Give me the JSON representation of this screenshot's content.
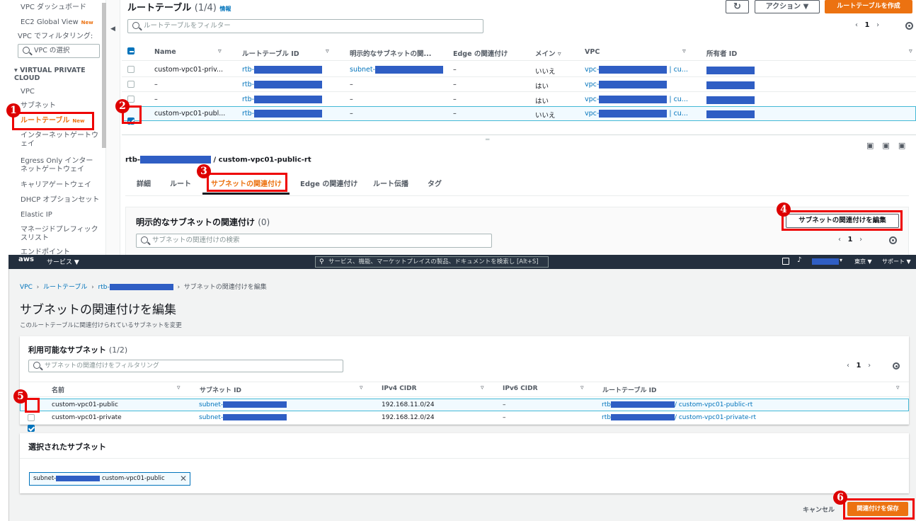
{
  "sidebar": {
    "items_top": [
      "VPC ダッシュボード",
      "EC2 Global View",
      "VPC でフィルタリング:"
    ],
    "ec2_new": "New",
    "vpc_select_placeholder": "VPC の選択",
    "section_title": "VIRTUAL PRIVATE CLOUD",
    "items": [
      "VPC",
      "サブネット",
      "ルートテーブル",
      "インターネットゲートウェイ",
      "Egress Only インターネットゲートウェイ",
      "キャリアゲートウェイ",
      "DHCP オプションセット",
      "Elastic IP",
      "マネージドプレフィックスリスト",
      "エンドポイント"
    ],
    "route_new": "New"
  },
  "top": {
    "title": "ルートテーブル",
    "count": "(1/4)",
    "info": "情報",
    "actions_label": "アクション ▼",
    "create_label": "ルートテーブルを作成",
    "filter_placeholder": "ルートテーブルをフィルター",
    "page": "1",
    "columns": [
      "Name",
      "ルートテーブル ID",
      "明示的なサブネットの関...",
      "Edge の関連付け",
      "メイン",
      "VPC",
      "所有者 ID"
    ],
    "rows": [
      {
        "name": "custom-vpc01-priv...",
        "rtb": "rtb-",
        "subnet": "subnet-",
        "edge": "–",
        "main": "いいえ",
        "vpc": "vpc-",
        "vpc_suffix": "| cu..."
      },
      {
        "name": "–",
        "rtb": "rtb-",
        "subnet": "–",
        "edge": "–",
        "main": "はい",
        "vpc": "vpc-",
        "vpc_suffix": ""
      },
      {
        "name": "–",
        "rtb": "rtb-",
        "subnet": "–",
        "edge": "–",
        "main": "はい",
        "vpc": "vpc-",
        "vpc_suffix": "| cu..."
      },
      {
        "name": "custom-vpc01-publ...",
        "rtb": "rtb-",
        "subnet": "–",
        "edge": "–",
        "main": "いいえ",
        "vpc": "vpc-",
        "vpc_suffix": "| cu..."
      }
    ]
  },
  "detail": {
    "header_prefix": "rtb-",
    "header_suffix": "/ custom-vpc01-public-rt",
    "tabs": [
      "詳細",
      "ルート",
      "サブネットの関連付け",
      "Edge の関連付け",
      "ルート伝播",
      "タグ"
    ],
    "explicit_title": "明示的なサブネットの関連付け",
    "explicit_count": "(0)",
    "edit_button": "サブネットの関連付けを編集",
    "search_placeholder": "サブネットの関連付けの検索",
    "page": "1"
  },
  "navbar": {
    "aws": "aws",
    "services": "サービス ▼",
    "search_placeholder": "サービス、機能、マーケットプレイスの製品、ドキュメントを検索し",
    "shortcut": "[Alt+S]",
    "region": "東京 ▼",
    "support": "サポート ▼"
  },
  "edit": {
    "breadcrumb": [
      "VPC",
      "ルートテーブル",
      "rtb-",
      "サブネットの関連付けを編集"
    ],
    "title": "サブネットの関連付けを編集",
    "subtitle": "このルートテーブルに関連付けられているサブネットを変更",
    "available_title": "利用可能なサブネット",
    "available_count": "(1/2)",
    "filter_placeholder": "サブネットの関連付けをフィルタリング",
    "page": "1",
    "columns": [
      "名前",
      "サブネット ID",
      "IPv4 CIDR",
      "IPv6 CIDR",
      "ルートテーブル ID"
    ],
    "rows": [
      {
        "name": "custom-vpc01-public",
        "subnet": "subnet-",
        "ipv4": "192.168.11.0/24",
        "ipv6": "–",
        "rtb": "rtb",
        "rtb_name": "/ custom-vpc01-public-rt"
      },
      {
        "name": "custom-vpc01-private",
        "subnet": "subnet-",
        "ipv4": "192.168.12.0/24",
        "ipv6": "–",
        "rtb": "rtb",
        "rtb_name": "/ custom-vpc01-private-rt"
      }
    ],
    "selected_title": "選択されたサブネット",
    "token_prefix": "subnet-",
    "token_name": "custom-vpc01-public",
    "cancel": "キャンセル",
    "save": "関連付けを保存"
  },
  "markers": [
    "1",
    "2",
    "3",
    "4",
    "5",
    "6"
  ]
}
